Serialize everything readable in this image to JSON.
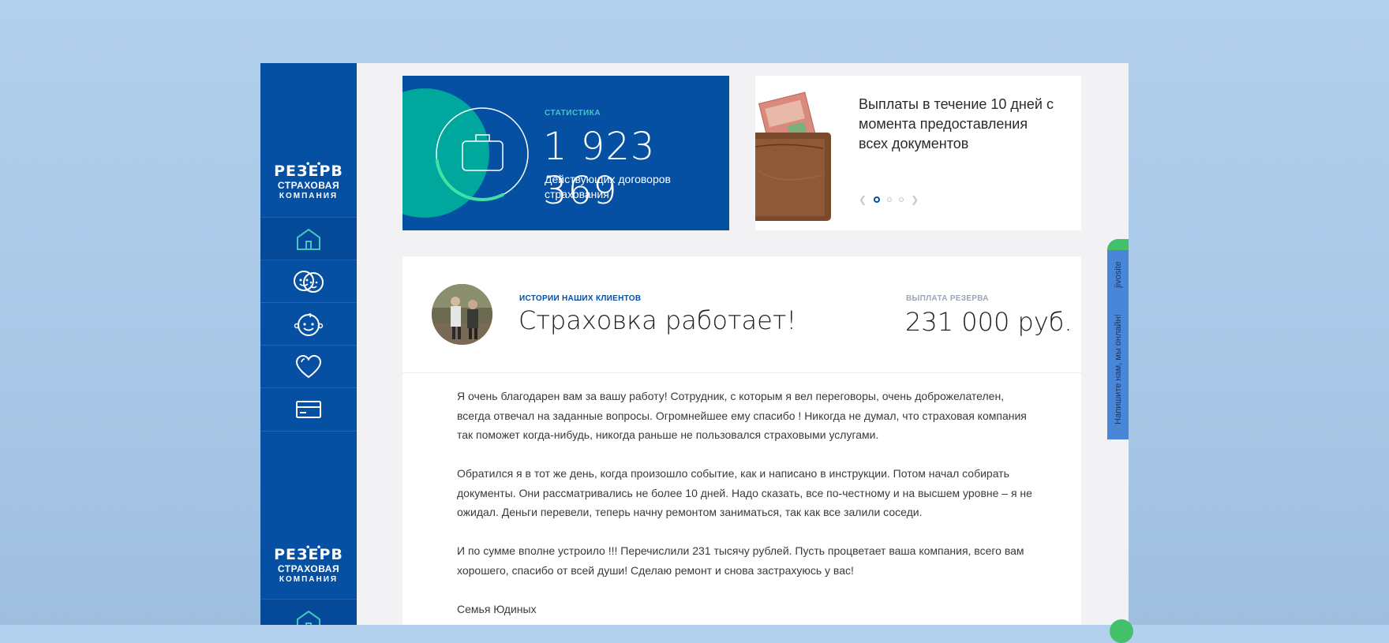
{
  "brand": {
    "line1": "РЕЗЕРВ",
    "dots": "• •",
    "line2": "СТРАХОВАЯ",
    "line3": "КОМПАНИЯ"
  },
  "sidebar": {
    "items": [
      {
        "icon": "home-icon"
      },
      {
        "icon": "family-icon"
      },
      {
        "icon": "child-icon"
      },
      {
        "icon": "heart-icon"
      },
      {
        "icon": "card-icon"
      }
    ]
  },
  "stats": {
    "label": "СТАТИСТИКА",
    "value": "1 923 369",
    "description": "Действующих договоров страхования",
    "progress_fraction": 0.3
  },
  "promo": {
    "text": "Выплаты в течение 10 дней с момента предоставления всех документов",
    "slides_total": 3,
    "active_slide": 1
  },
  "story": {
    "label": "ИСТОРИИ НАШИХ КЛИЕНТОВ",
    "title": "Страховка работает!",
    "payout_label": "ВЫПЛАТА РЕЗЕРВА",
    "payout_value": "231 000 руб.",
    "paragraphs": [
      "Я очень благодарен вам за вашу работу! Сотрудник, с которым я вел переговоры, очень доброжелателен, всегда отвечал на заданные вопросы. Огромнейшее ему спасибо ! Никогда не думал, что страховая компания так поможет когда-нибудь, никогда раньше не пользовался страховыми услугами.",
      "Обратился я в тот же день, когда произошло событие, как и написано в инструкции. Потом начал собирать документы. Они рассматривались не более 10 дней. Надо сказать, все по-честному и на высшем уровне – я не ожидал. Деньги перевели, теперь начну ремонтом заниматься, так как все залили соседи.",
      "И по сумме вполне устроило !!! Перечислили 231 тысячу рублей. Пусть процветает ваша компания, всего вам хорошего, спасибо от всей души!  Сделаю ремонт и снова застрахуюсь у вас!",
      "Семья Юдиных"
    ]
  },
  "chat": {
    "brand": "jivosite",
    "prompt": "Напишите нам, мы онлайн!"
  },
  "colors": {
    "primary": "#0550a3",
    "teal": "#00a79d",
    "accent_green": "#43c06a",
    "chat_blue": "#4a86d8"
  }
}
